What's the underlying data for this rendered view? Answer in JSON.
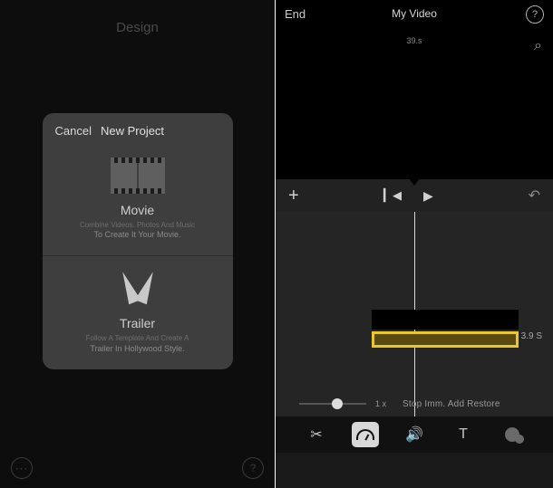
{
  "left": {
    "header": "Design",
    "modal": {
      "cancel": "Cancel",
      "title": "New Project",
      "movie": {
        "title": "Movie",
        "desc1": "Combine Videos. Photos And Music",
        "desc2": "To Create It Your Movie."
      },
      "trailer": {
        "title": "Trailer",
        "desc1": "Follow A Template And Create A",
        "desc2": "Trailer In Hollywood Style."
      }
    },
    "more_icon": "⋯",
    "help_icon": "?"
  },
  "right": {
    "end": "End",
    "title": "My Video",
    "help_icon": "?",
    "zoom_icon": "⌕",
    "preview_time": "39.s",
    "toolbar": {
      "add": "+",
      "prev": "▎◀",
      "play": "▶",
      "undo": "↶"
    },
    "clip_time": "3.9 S",
    "zoom": {
      "label": "1 x",
      "text": "Stop Imm. Add Restore"
    },
    "bottom": {
      "cut": "✂",
      "vol": "🔊",
      "text": "T"
    }
  }
}
